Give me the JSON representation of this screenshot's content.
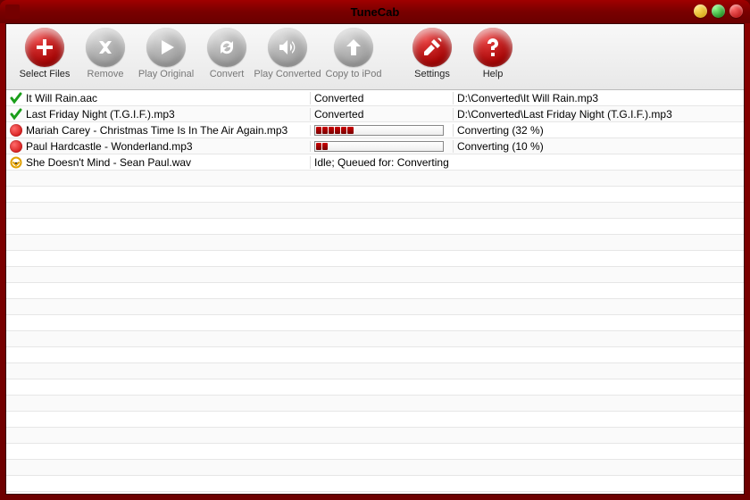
{
  "appTitle": "TuneCab",
  "toolbar": [
    {
      "id": "select-files",
      "label": "Select Files",
      "style": "red",
      "icon": "plus",
      "enabled": true
    },
    {
      "id": "remove",
      "label": "Remove",
      "style": "gray",
      "icon": "x",
      "enabled": false
    },
    {
      "id": "play-orig",
      "label": "Play Original",
      "style": "gray",
      "icon": "play",
      "enabled": false
    },
    {
      "id": "convert",
      "label": "Convert",
      "style": "gray",
      "icon": "cycle",
      "enabled": false
    },
    {
      "id": "play-conv",
      "label": "Play Converted",
      "style": "gray",
      "icon": "speaker",
      "enabled": false
    },
    {
      "id": "copy-ipod",
      "label": "Copy to iPod",
      "style": "gray",
      "icon": "up",
      "enabled": false
    },
    {
      "id": "settings",
      "label": "Settings",
      "style": "red",
      "icon": "tools",
      "enabled": true,
      "gapBefore": true
    },
    {
      "id": "help",
      "label": "Help",
      "style": "red",
      "icon": "question",
      "enabled": true
    }
  ],
  "files": [
    {
      "status": "done",
      "name": "It Will Rain.aac",
      "col2Text": "Converted",
      "col3": "D:\\Converted\\It Will Rain.mp3"
    },
    {
      "status": "done",
      "name": "Last Friday Night (T.G.I.F.).mp3",
      "col2Text": "Converted",
      "col3": "D:\\Converted\\Last Friday Night (T.G.I.F.).mp3"
    },
    {
      "status": "busy",
      "name": "Mariah Carey - Christmas Time Is In The Air Again.mp3",
      "progress": 32,
      "segs": 6,
      "col3": "Converting (32 %)"
    },
    {
      "status": "busy",
      "name": "Paul Hardcastle - Wonderland.mp3",
      "progress": 10,
      "segs": 2,
      "col3": "Converting (10 %)"
    },
    {
      "status": "queued",
      "name": "She Doesn't Mind - Sean Paul.wav",
      "col2Text": "Idle; Queued for: Converting",
      "col3": ""
    }
  ],
  "totalRows": 25
}
